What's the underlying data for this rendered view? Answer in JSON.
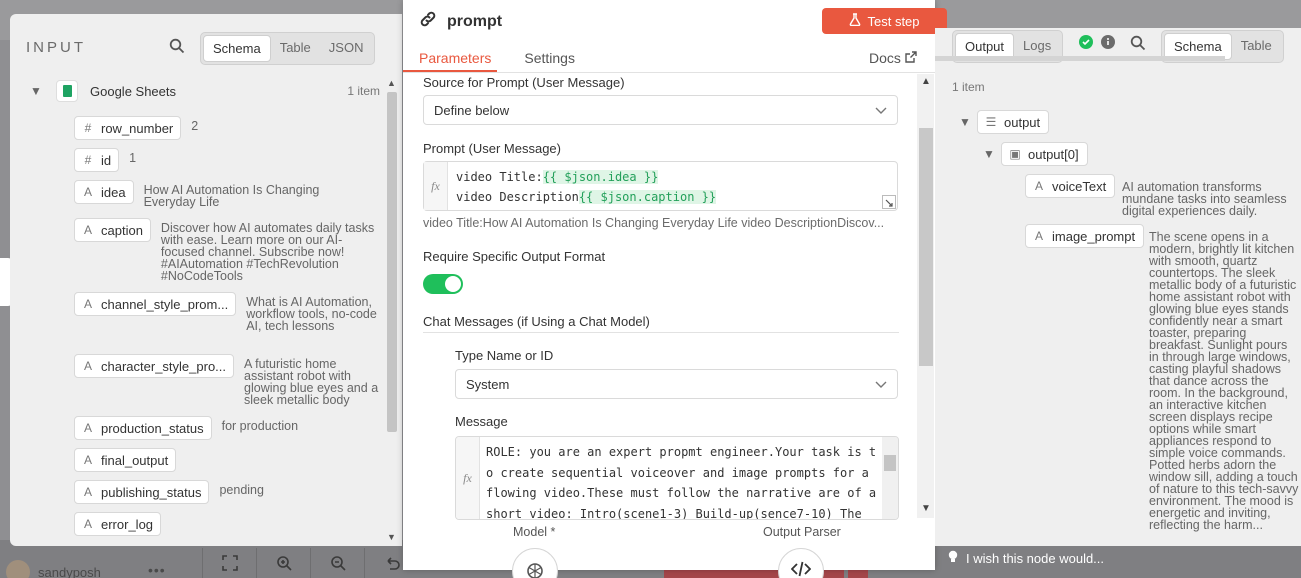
{
  "background": {
    "user_name": "sandyposh",
    "menu_dots": "•••",
    "wish_text": "I wish this node would..."
  },
  "input": {
    "title": "INPUT",
    "view_tabs": [
      "Schema",
      "Table",
      "JSON"
    ],
    "active_tab": "Schema",
    "source": {
      "name": "Google Sheets",
      "count": "1 item"
    },
    "fields": [
      {
        "type": "#",
        "name": "row_number",
        "value": "2"
      },
      {
        "type": "#",
        "name": "id",
        "value": "1"
      },
      {
        "type": "A",
        "name": "idea",
        "value": "How AI Automation Is Changing Everyday Life"
      },
      {
        "type": "A",
        "name": "caption",
        "value": "Discover how AI automates daily tasks with ease. Learn more on our AI-focused channel. Subscribe now! #AIAutomation #TechRevolution #NoCodeTools"
      },
      {
        "type": "A",
        "name": "channel_style_prom...",
        "value": "What is AI Automation, workflow tools, no-code AI, tech lessons"
      },
      {
        "type": "A",
        "name": "character_style_pro...",
        "value": "A futuristic home assistant robot with glowing blue eyes and a sleek metallic body"
      },
      {
        "type": "A",
        "name": "production_status",
        "value": "for production"
      },
      {
        "type": "A",
        "name": "final_output",
        "value": ""
      },
      {
        "type": "A",
        "name": "publishing_status",
        "value": "pending"
      },
      {
        "type": "A",
        "name": "error_log",
        "value": ""
      }
    ]
  },
  "node": {
    "title": "prompt",
    "test_button": "Test step",
    "tabs": [
      "Parameters",
      "Settings"
    ],
    "docs": "Docs",
    "source_label": "Source for Prompt (User Message)",
    "source_value": "Define below",
    "prompt_label": "Prompt (User Message)",
    "fx": "fx",
    "prompt_lines": [
      {
        "text": "video Title:",
        "expr": "{{ $json.idea }}"
      },
      {
        "text": "video Description",
        "expr": "{{ $json.caption }}"
      }
    ],
    "prompt_preview": "video Title:How AI Automation Is Changing Everyday Life video DescriptionDiscov...",
    "require_label": "Require Specific Output Format",
    "require_on": true,
    "chat_label": "Chat Messages (if Using a Chat Model)",
    "type_label": "Type Name or ID",
    "type_value": "System",
    "message_label": "Message",
    "message_text": "ROLE: you are an expert propmt engineer.Your task is to create sequential voiceover and image prompts for a flowing video.These must follow the narrative are of a short video: Intro(scene1-3) Build-up(sence7-10)  The",
    "model_label": "Model *",
    "parser_label": "Output Parser"
  },
  "output": {
    "tabs_left": [
      "Output",
      "Logs"
    ],
    "active_left": "Output",
    "tabs_right": [
      "Schema",
      "Table"
    ],
    "active_right": "Schema",
    "count": "1 item",
    "root": "output",
    "child": "output[0]",
    "fields": [
      {
        "type": "A",
        "name": "voiceText",
        "value": "AI automation transforms mundane tasks into seamless digital experiences daily."
      },
      {
        "type": "A",
        "name": "image_prompt",
        "value": "The scene opens in a modern, brightly lit kitchen with smooth, quartz countertops. The sleek metallic body of a futuristic home assistant robot with glowing blue eyes stands confidently near a smart toaster, preparing breakfast. Sunlight pours in through large windows, casting playful shadows that dance across the room. In the background, an interactive kitchen screen displays recipe options while smart appliances respond to simple voice commands. Potted herbs adorn the window sill, adding a touch of nature to this tech-savvy environment. The mood is energetic and inviting, reflecting the harm..."
      }
    ]
  },
  "colors": {
    "accent": "#e9583f",
    "toggle": "#1fbf5b",
    "success": "#1fbf5b"
  }
}
